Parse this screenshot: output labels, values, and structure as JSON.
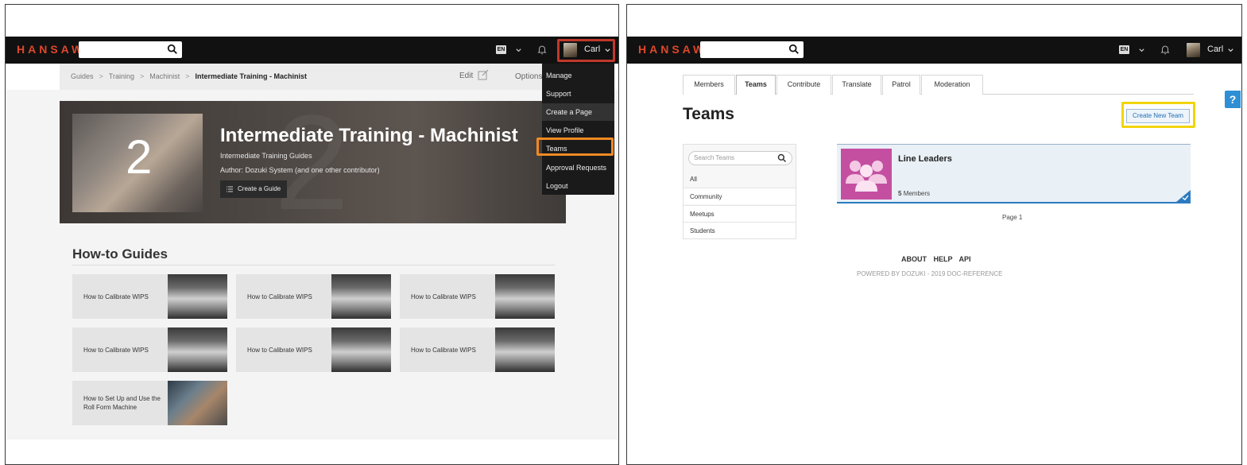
{
  "left": {
    "logo": "HANSAW",
    "lang": "EN",
    "user": "Carl",
    "breadcrumb": [
      "Guides",
      "Training",
      "Machinist"
    ],
    "breadcrumb_current": "Intermediate Training - Machinist",
    "edit_label": "Edit",
    "options_label": "Options",
    "hero": {
      "number": "2",
      "title": "Intermediate Training - Machinist",
      "subtitle": "Intermediate Training Guides",
      "author": "Author: Dozuki System (and one other contributor)",
      "create_guide": "Create a Guide"
    },
    "menu": [
      "Manage",
      "Support",
      "Create a Page",
      "View Profile",
      "Teams",
      "Approval Requests",
      "Logout"
    ],
    "guides_heading": "How-to Guides",
    "guides": [
      "How to Calibrate WIPS",
      "How to Calibrate WIPS",
      "How to Calibrate WIPS",
      "How to Calibrate WIPS",
      "How to Calibrate WIPS",
      "How to Calibrate WIPS",
      "How to Set Up and Use the Roll Form Machine"
    ]
  },
  "right": {
    "logo": "HANSAW",
    "lang": "EN",
    "user": "Carl",
    "tabs": [
      "Members",
      "Teams",
      "Contribute",
      "Translate",
      "Patrol",
      "Moderation"
    ],
    "title": "Teams",
    "create_new_team": "Create New Team",
    "help": "?",
    "search_placeholder": "Search Teams",
    "categories": [
      "All",
      "Community",
      "Meetups",
      "Students"
    ],
    "team": {
      "name": "Line Leaders",
      "count": "5",
      "members_word": "Members"
    },
    "page": "Page 1",
    "footer_links": "ABOUT HELP API",
    "powered": "POWERED BY DOZUKI - 2019 DOC-REFERENCE"
  },
  "colors": {
    "topbar": "#111111",
    "logo": "#e0472a",
    "highlight_red": "#c0392b",
    "highlight_orange": "#f08a24",
    "highlight_yellow": "#f2d40c",
    "team_avatar": "#c44fa0",
    "link_blue": "#1f6fb4"
  },
  "icons": [
    "search-icon",
    "chevron-down-icon",
    "bell-icon",
    "avatar",
    "edit-icon",
    "list-icon",
    "team-group-icon",
    "check-icon",
    "help-icon"
  ]
}
